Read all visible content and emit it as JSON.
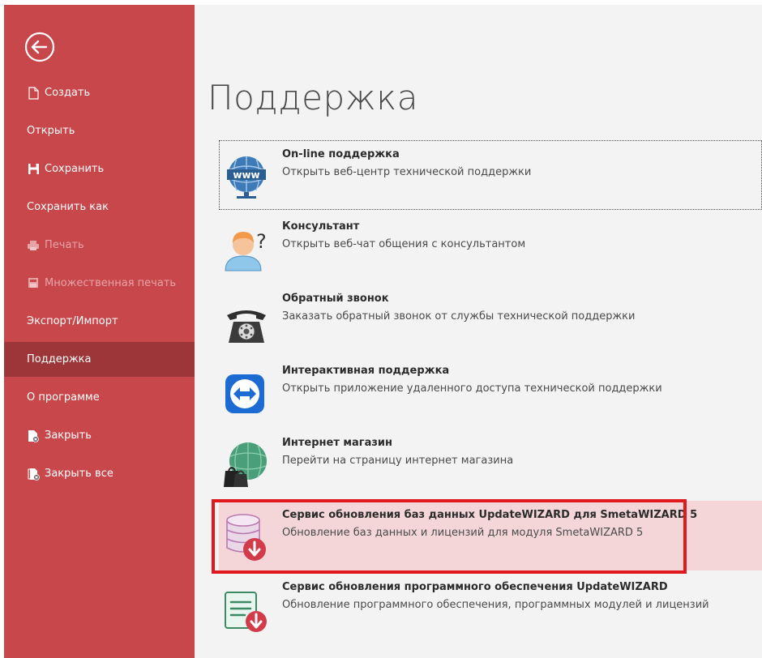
{
  "sidebar": {
    "items": [
      {
        "label": "Создать"
      },
      {
        "label": "Открыть"
      },
      {
        "label": "Сохранить"
      },
      {
        "label": "Сохранить как"
      },
      {
        "label": "Печать"
      },
      {
        "label": "Множественная печать"
      },
      {
        "label": "Экспорт/Импорт"
      },
      {
        "label": "Поддержка"
      },
      {
        "label": "О программе"
      },
      {
        "label": "Закрыть"
      },
      {
        "label": "Закрыть все"
      }
    ],
    "selected": "Поддержка",
    "background": "#c8474a",
    "selected_background": "#9c3638"
  },
  "main": {
    "title": "Поддержка",
    "items": [
      {
        "title": "On-line поддержка",
        "desc": "Открыть веб-центр технической поддержки",
        "icon": "www-globe-icon"
      },
      {
        "title": "Консультант",
        "desc": "Открыть веб-чат общения с консультантом",
        "icon": "consultant-icon"
      },
      {
        "title": "Обратный звонок",
        "desc": "Заказать обратный звонок от службы технической поддержки",
        "icon": "phone-icon"
      },
      {
        "title": "Интерактивная поддержка",
        "desc": "Открыть приложение удаленного доступа технической поддержки",
        "icon": "remote-access-icon"
      },
      {
        "title": "Интернет магазин",
        "desc": "Перейти на страницу интернет магазина",
        "icon": "shop-globe-icon"
      },
      {
        "title": "Сервис обновления баз данных UpdateWIZARD для SmetaWIZARD 5",
        "desc": "Обновление баз данных и лицензий для модуля SmetaWIZARD 5",
        "icon": "database-update-icon"
      },
      {
        "title": "Сервис обновления программного обеспечения UpdateWIZARD",
        "desc": "Обновление программного обеспечения, программных модулей и лицензий",
        "icon": "software-update-icon"
      }
    ],
    "highlight_color": "#f4d6d8",
    "annotation_color": "#e0191f"
  }
}
